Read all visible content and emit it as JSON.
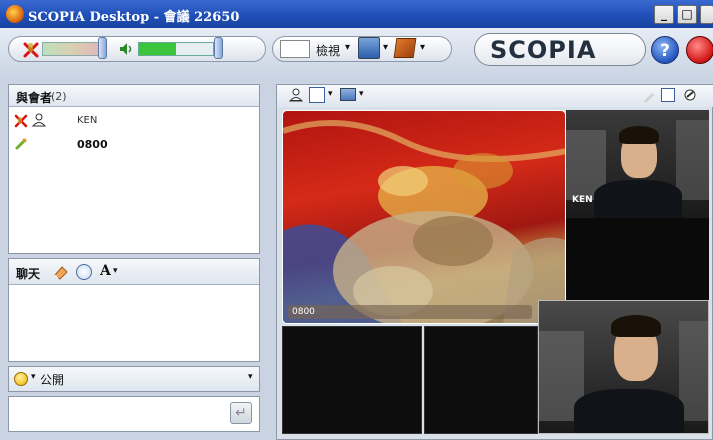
{
  "window": {
    "title": "SCOPIA Desktop - 會議 22650",
    "min_glyph": "_",
    "max_glyph": "□"
  },
  "toolbar": {
    "view_label": "檢視",
    "view_caret": "▾",
    "monitor_caret": "▾",
    "box_caret": "▾",
    "brand": "SCOPIA",
    "help_glyph": "?"
  },
  "participants": {
    "title": "與會者",
    "count": "(2)",
    "rows": [
      {
        "name": "KEN"
      },
      {
        "name": "0800"
      }
    ]
  },
  "chat": {
    "title": "聊天",
    "font_glyph": "A",
    "font_caret": "▾"
  },
  "scope": {
    "label": "公開",
    "caret": "▾",
    "dropdown": "▾"
  },
  "composer": {
    "send_glyph": "↵"
  },
  "video_toolbar": {
    "layout_caret": "▾",
    "screen_caret": "▾"
  },
  "videos": {
    "main_label": "0800",
    "ken_label": "KEN"
  }
}
